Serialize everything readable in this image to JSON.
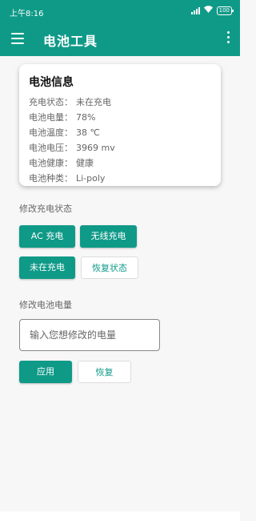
{
  "status_bar": {
    "time": "上午8:16",
    "battery": "100"
  },
  "app_bar": {
    "title": "电池工具"
  },
  "battery_card": {
    "title": "电池信息",
    "rows": [
      {
        "label": "充电状态：",
        "value": "未在充电"
      },
      {
        "label": "电池电量：",
        "value": "78%"
      },
      {
        "label": "电池温度：",
        "value": "38 ℃"
      },
      {
        "label": "电池电压：",
        "value": "3969 mv"
      },
      {
        "label": "电池健康：",
        "value": "健康"
      },
      {
        "label": "电池种类：",
        "value": "Li-poly"
      }
    ]
  },
  "charge_section": {
    "title": "修改充电状态",
    "ac_label": "AC 充电",
    "wireless_label": "无线充电",
    "not_charging_label": "未在充电",
    "restore_label": "恢复状态"
  },
  "level_section": {
    "title": "修改电池电量",
    "input_placeholder": "输入您想修改的电量",
    "apply_label": "应用",
    "restore_label": "恢复"
  },
  "colors": {
    "accent": "#0f9a88",
    "background": "#f7f7f7"
  }
}
